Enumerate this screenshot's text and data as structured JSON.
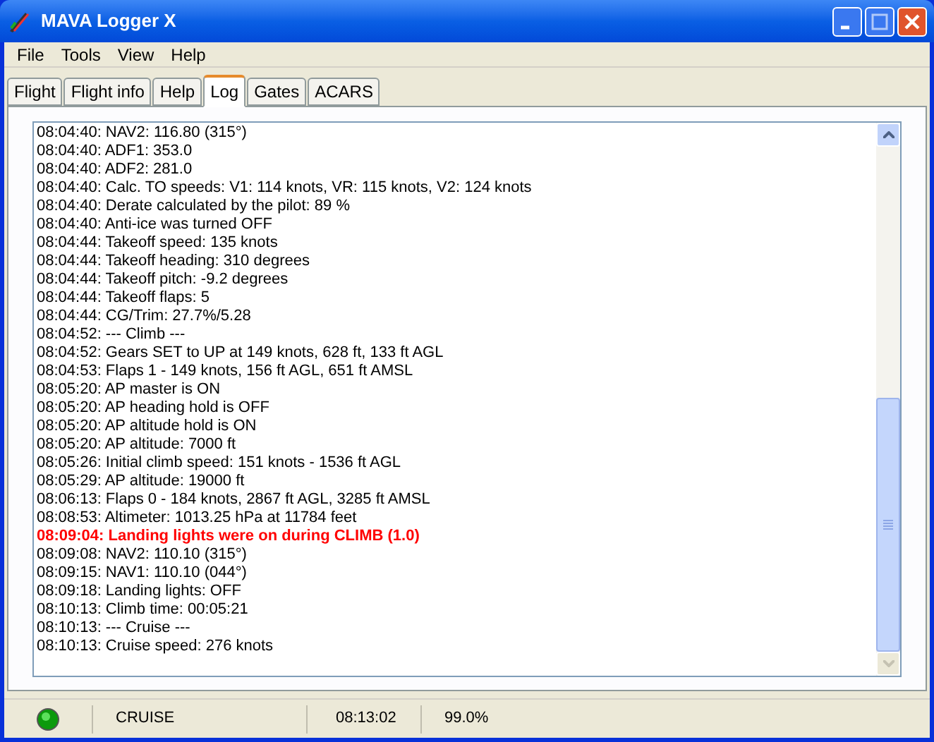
{
  "window": {
    "title": "MAVA Logger X"
  },
  "menu": [
    "File",
    "Tools",
    "View",
    "Help"
  ],
  "tabs": [
    {
      "label": "Flight",
      "selected": false
    },
    {
      "label": "Flight info",
      "selected": false
    },
    {
      "label": "Help",
      "selected": false
    },
    {
      "label": "Log",
      "selected": true
    },
    {
      "label": "Gates",
      "selected": false
    },
    {
      "label": "ACARS",
      "selected": false
    }
  ],
  "log": [
    {
      "kind": "normal",
      "text": "08:04:40: NAV2: 116.80 (315°)"
    },
    {
      "kind": "normal",
      "text": "08:04:40: ADF1: 353.0"
    },
    {
      "kind": "normal",
      "text": "08:04:40: ADF2: 281.0"
    },
    {
      "kind": "normal",
      "text": "08:04:40: Calc. TO speeds: V1: 114 knots, VR: 115 knots, V2: 124 knots"
    },
    {
      "kind": "normal",
      "text": "08:04:40: Derate calculated by the pilot: 89 %"
    },
    {
      "kind": "normal",
      "text": "08:04:40: Anti-ice was turned OFF"
    },
    {
      "kind": "normal",
      "text": "08:04:44: Takeoff speed: 135 knots"
    },
    {
      "kind": "normal",
      "text": "08:04:44: Takeoff heading: 310 degrees"
    },
    {
      "kind": "normal",
      "text": "08:04:44: Takeoff pitch: -9.2 degrees"
    },
    {
      "kind": "normal",
      "text": "08:04:44: Takeoff flaps: 5"
    },
    {
      "kind": "normal",
      "text": "08:04:44: CG/Trim: 27.7%/5.28"
    },
    {
      "kind": "normal",
      "text": "08:04:52: --- Climb ---"
    },
    {
      "kind": "normal",
      "text": "08:04:52: Gears SET to UP at 149 knots, 628 ft, 133 ft AGL"
    },
    {
      "kind": "normal",
      "text": "08:04:53: Flaps 1 - 149 knots, 156 ft AGL, 651 ft AMSL"
    },
    {
      "kind": "normal",
      "text": "08:05:20: AP master is ON"
    },
    {
      "kind": "normal",
      "text": "08:05:20: AP heading hold is OFF"
    },
    {
      "kind": "normal",
      "text": "08:05:20: AP altitude hold is ON"
    },
    {
      "kind": "normal",
      "text": "08:05:20: AP altitude: 7000 ft"
    },
    {
      "kind": "normal",
      "text": "08:05:26: Initial climb speed: 151 knots - 1536 ft AGL"
    },
    {
      "kind": "normal",
      "text": "08:05:29: AP altitude: 19000 ft"
    },
    {
      "kind": "normal",
      "text": "08:06:13: Flaps 0 - 184 knots, 2867 ft AGL, 3285 ft AMSL"
    },
    {
      "kind": "normal",
      "text": "08:08:53: Altimeter: 1013.25 hPa at 11784 feet"
    },
    {
      "kind": "alert",
      "text": "08:09:04: Landing lights were on during CLIMB (1.0)"
    },
    {
      "kind": "normal",
      "text": "08:09:08: NAV2: 110.10 (315°)"
    },
    {
      "kind": "normal",
      "text": "08:09:15: NAV1: 110.10 (044°)"
    },
    {
      "kind": "normal",
      "text": "08:09:18: Landing lights: OFF"
    },
    {
      "kind": "normal",
      "text": "08:10:13: Climb time: 00:05:21"
    },
    {
      "kind": "normal",
      "text": "08:10:13: --- Cruise ---"
    },
    {
      "kind": "normal",
      "text": "08:10:13: Cruise speed: 276 knots"
    }
  ],
  "status_bar": {
    "phase": "CRUISE",
    "time": "08:13:02",
    "percent": "99.0%"
  }
}
